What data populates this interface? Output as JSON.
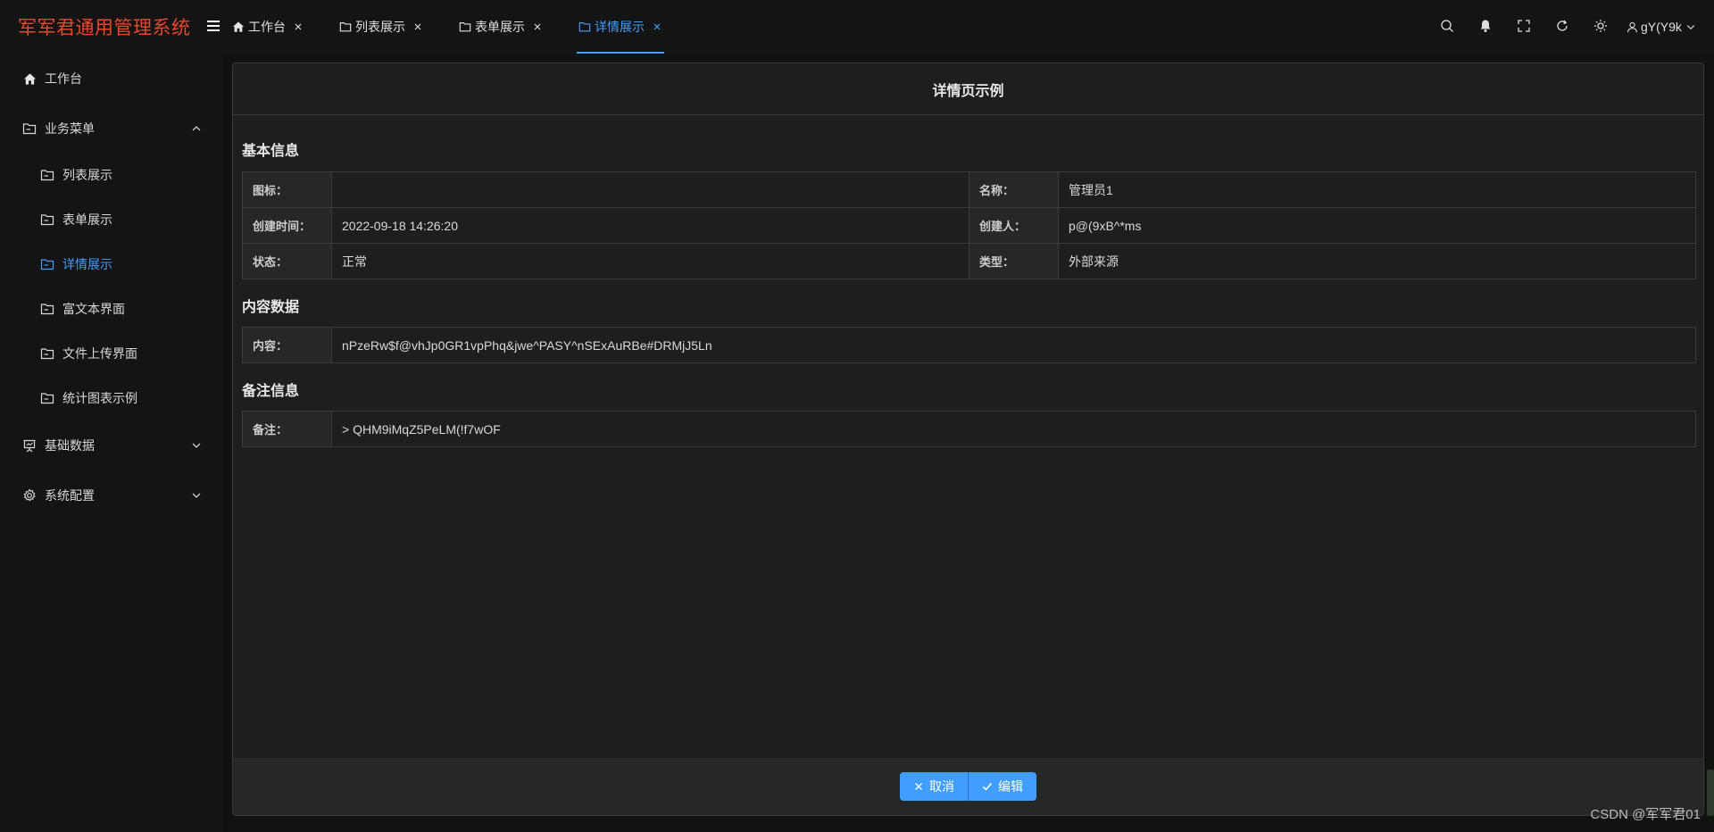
{
  "app": {
    "title": "军军君通用管理系统",
    "accent": "#409eff",
    "logo_color": "#e8482b"
  },
  "sidebar": {
    "items": [
      {
        "label": "工作台",
        "icon": "home-icon",
        "level": 1
      },
      {
        "label": "业务菜单",
        "icon": "folder-icon",
        "level": 1,
        "expanded": true
      },
      {
        "label": "列表展示",
        "icon": "folder-icon",
        "level": 2
      },
      {
        "label": "表单展示",
        "icon": "folder-icon",
        "level": 2
      },
      {
        "label": "详情展示",
        "icon": "folder-icon",
        "level": 2,
        "active": true
      },
      {
        "label": "富文本界面",
        "icon": "folder-icon",
        "level": 2
      },
      {
        "label": "文件上传界面",
        "icon": "folder-icon",
        "level": 2
      },
      {
        "label": "统计图表示例",
        "icon": "folder-icon",
        "level": 2
      },
      {
        "label": "基础数据",
        "icon": "presentation-icon",
        "level": 1,
        "expanded": false
      },
      {
        "label": "系统配置",
        "icon": "gear-icon",
        "level": 1,
        "expanded": false
      }
    ]
  },
  "tabs": [
    {
      "label": "工作台",
      "icon": "home-icon"
    },
    {
      "label": "列表展示",
      "icon": "folder-icon"
    },
    {
      "label": "表单展示",
      "icon": "folder-icon"
    },
    {
      "label": "详情展示",
      "icon": "folder-icon",
      "active": true
    }
  ],
  "header": {
    "user_name": "gY(Y9k"
  },
  "page": {
    "title": "详情页示例",
    "sections": {
      "basic": "基本信息",
      "content": "内容数据",
      "remark": "备注信息"
    },
    "basic_rows": [
      {
        "label1": "图标：",
        "value1": "",
        "label2": "名称：",
        "value2": "管理员1"
      },
      {
        "label1": "创建时间：",
        "value1": "2022-09-18 14:26:20",
        "label2": "创建人：",
        "value2": "p@(9xB^*ms"
      },
      {
        "label1": "状态：",
        "value1": "正常",
        "label2": "类型：",
        "value2": "外部来源"
      }
    ],
    "content_row": {
      "label": "内容：",
      "value": "nPzeRw$f@vhJp0GR1vpPhq&jwe^PASY^nSExAuRBe#DRMjJ5Ln"
    },
    "remark_row": {
      "label": "备注：",
      "value": "> QHM9iMqZ5PeLM(!f7wOF"
    },
    "buttons": {
      "cancel": "取消",
      "edit": "编辑"
    }
  },
  "watermark": "CSDN @军军君01"
}
